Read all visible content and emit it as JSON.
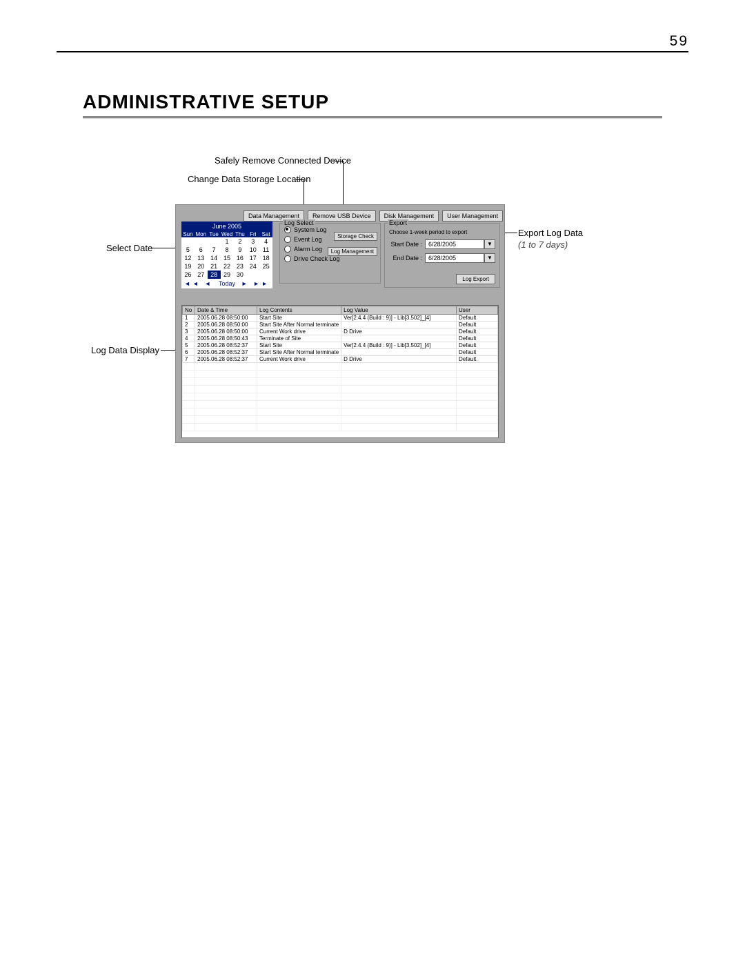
{
  "page": {
    "number": "59",
    "title": "ADMINISTRATIVE SETUP"
  },
  "callouts": {
    "safely_remove": "Safely Remove Connected Device",
    "change_storage": "Change Data Storage Location",
    "select_date": "Select Date",
    "log_display": "Log Data Display",
    "export_log": "Export Log Data",
    "export_hint": "(1 to 7 days)"
  },
  "tabs": {
    "data_mgmt": "Data Management",
    "remove_usb": "Remove USB Device",
    "disk_mgmt": "Disk Management",
    "user_mgmt": "User Management"
  },
  "calendar": {
    "title": "June 2005",
    "dow": [
      "Sun",
      "Mon",
      "Tue",
      "Wed",
      "Thu",
      "Fri",
      "Sat"
    ],
    "cells": [
      "",
      "",
      "",
      "1",
      "2",
      "3",
      "4",
      "5",
      "6",
      "7",
      "8",
      "9",
      "10",
      "11",
      "12",
      "13",
      "14",
      "15",
      "16",
      "17",
      "18",
      "19",
      "20",
      "21",
      "22",
      "23",
      "24",
      "25",
      "26",
      "27",
      "28",
      "29",
      "30",
      "",
      ""
    ],
    "selected": "28",
    "nav_prev": "◄◄  ◄",
    "today": "Today",
    "nav_next": "►  ►►"
  },
  "log_select": {
    "legend": "Log Select",
    "system_log": "System Log",
    "event_log": "Event Log",
    "alarm_log": "Alarm Log",
    "drive_check_log": "Drive Check Log",
    "storage_check": "Storage Check",
    "log_management": "Log Management"
  },
  "export": {
    "legend": "Export",
    "hint": "Choose 1-week period to export",
    "start_label": "Start Date :",
    "start_value": "6/28/2005",
    "end_label": "End Date :",
    "end_value": "6/28/2005",
    "button": "Log Export"
  },
  "log_table": {
    "headers": {
      "no": "No",
      "datetime": "Date & Time",
      "contents": "Log Contents",
      "value": "Log Value",
      "user": "User"
    },
    "rows": [
      {
        "no": "1",
        "dt": "2005.06.28 08:50:00",
        "c": "Start Site",
        "v": "Ver[2.4.4 (Build : 9)] - Lib[3.502]_[4]",
        "u": "Default"
      },
      {
        "no": "2",
        "dt": "2005.06.28 08:50:00",
        "c": "Start Site After Normal terminate",
        "v": "",
        "u": "Default"
      },
      {
        "no": "3",
        "dt": "2005.06.28 08:50:00",
        "c": "Current Work drive",
        "v": "D Drive",
        "u": "Default"
      },
      {
        "no": "4",
        "dt": "2005.06.28 08:50:43",
        "c": "Terminate of Site",
        "v": "",
        "u": "Default"
      },
      {
        "no": "5",
        "dt": "2005.06.28 08:52:37",
        "c": "Start Site",
        "v": "Ver[2.4.4 (Build : 9)] - Lib[3.502]_[4]",
        "u": "Default"
      },
      {
        "no": "6",
        "dt": "2005.06.28 08:52:37",
        "c": "Start Site After Normal terminate",
        "v": "",
        "u": "Default"
      },
      {
        "no": "7",
        "dt": "2005.06.28 08:52:37",
        "c": "Current Work drive",
        "v": "D Drive",
        "u": "Default"
      }
    ]
  }
}
